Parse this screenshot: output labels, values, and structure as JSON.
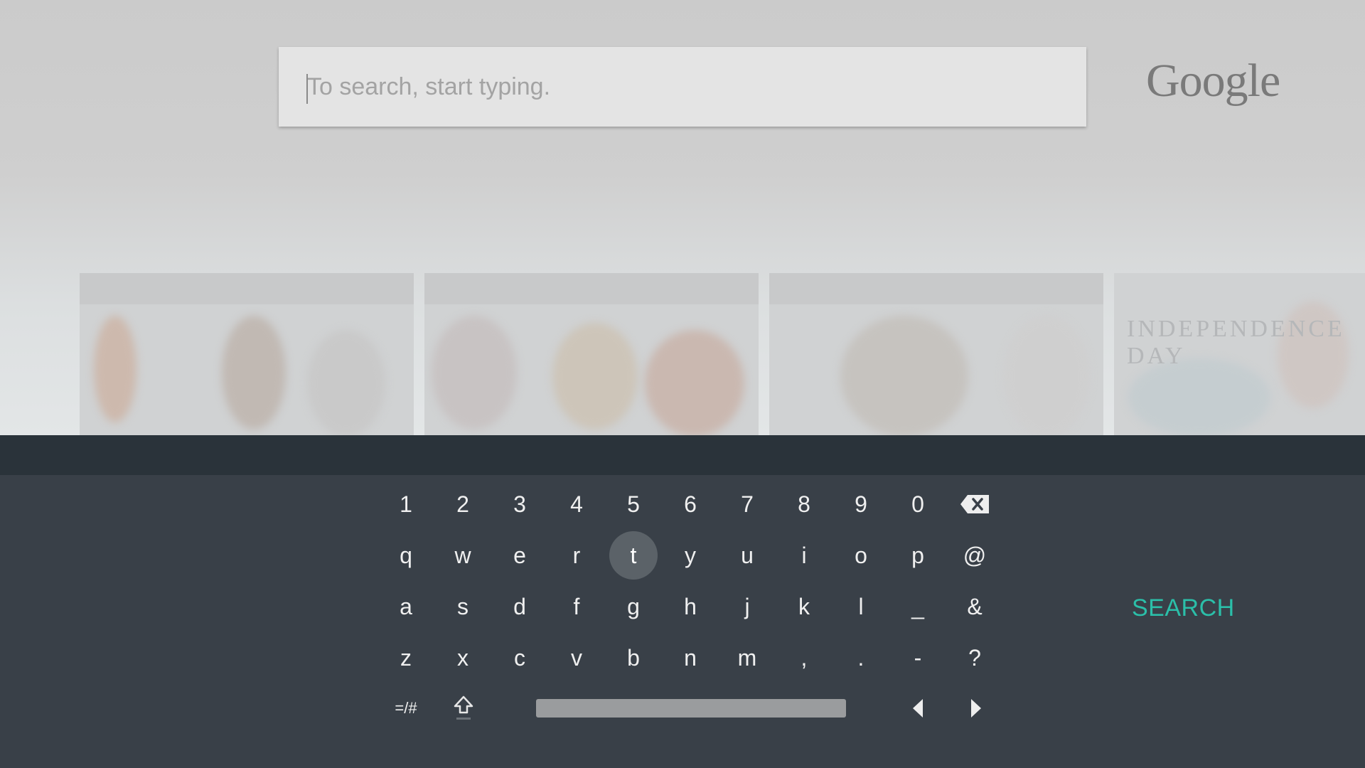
{
  "search": {
    "placeholder": "To search, start typing.",
    "value": ""
  },
  "brand": {
    "logo_text": "Google"
  },
  "background_cards": [
    {
      "title": ""
    },
    {
      "title": ""
    },
    {
      "title": ""
    },
    {
      "title": "INDEPENDENCE DAY"
    }
  ],
  "keyboard": {
    "rows": [
      [
        "1",
        "2",
        "3",
        "4",
        "5",
        "6",
        "7",
        "8",
        "9",
        "0"
      ],
      [
        "q",
        "w",
        "e",
        "r",
        "t",
        "y",
        "u",
        "i",
        "o",
        "p",
        "@"
      ],
      [
        "a",
        "s",
        "d",
        "f",
        "g",
        "h",
        "j",
        "k",
        "l",
        "_",
        "&"
      ],
      [
        "z",
        "x",
        "c",
        "v",
        "b",
        "n",
        "m",
        ",",
        ".",
        "-",
        "?"
      ]
    ],
    "focused_key": "t",
    "symbols_toggle": "=/#",
    "icons": {
      "backspace": "backspace-icon",
      "shift": "shift-icon",
      "left": "arrow-left-icon",
      "right": "arrow-right-icon"
    },
    "search_action": "SEARCH",
    "accent_color": "#2bbfa9",
    "background_color": "#394048"
  }
}
